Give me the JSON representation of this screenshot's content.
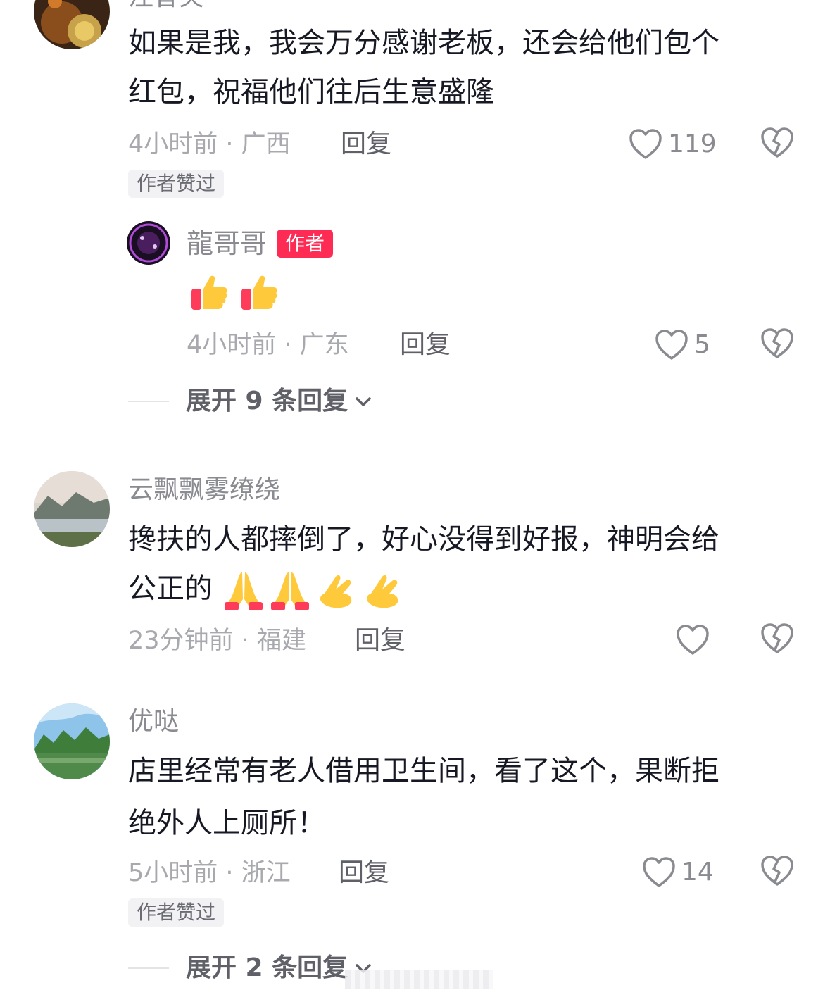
{
  "comments": [
    {
      "username": "注昔笑",
      "text_line1": "如果是我，我会万分感谢老板，还会给他们包个",
      "text_line2": "红包，祝福他们往后生意盛隆",
      "time": "4小时前",
      "location": "广西",
      "reply_label": "回复",
      "likes": "119",
      "author_liked_badge": "作者赞过",
      "avatar_icon": "tea-cup-avatar",
      "reply": {
        "username": "龍哥哥",
        "author_badge": "作者",
        "text_emoji": "👍👍",
        "emoji_icon": "thumbs-up-icon",
        "time": "4小时前",
        "location": "广东",
        "reply_label": "回复",
        "likes": "5"
      },
      "expand_label": "展开 9 条回复"
    },
    {
      "username": "云飘飘雾缭绕",
      "text_line1": "搀扶的人都摔倒了，好心没得到好报，神明会给",
      "text_line2": "公正的",
      "emoji_icon": "praying-hands-icon",
      "time": "23分钟前",
      "location": "福建",
      "reply_label": "回复",
      "likes": "",
      "avatar_icon": "river-landscape-avatar"
    },
    {
      "username": "优哒",
      "text_line1": "店里经常有老人借用卫生间，看了这个，果断拒",
      "text_line2": "绝外人上厕所！",
      "time": "5小时前",
      "location": "浙江",
      "reply_label": "回复",
      "likes": "14",
      "author_liked_badge": "作者赞过",
      "avatar_icon": "lake-landscape-avatar",
      "expand_label": "展开 2 条回复"
    }
  ],
  "colors": {
    "text": "#161823",
    "meta": "#a8a9ae",
    "username": "#8a8b91",
    "author_badge": "#fe2c55",
    "icon": "#8a8b91"
  }
}
